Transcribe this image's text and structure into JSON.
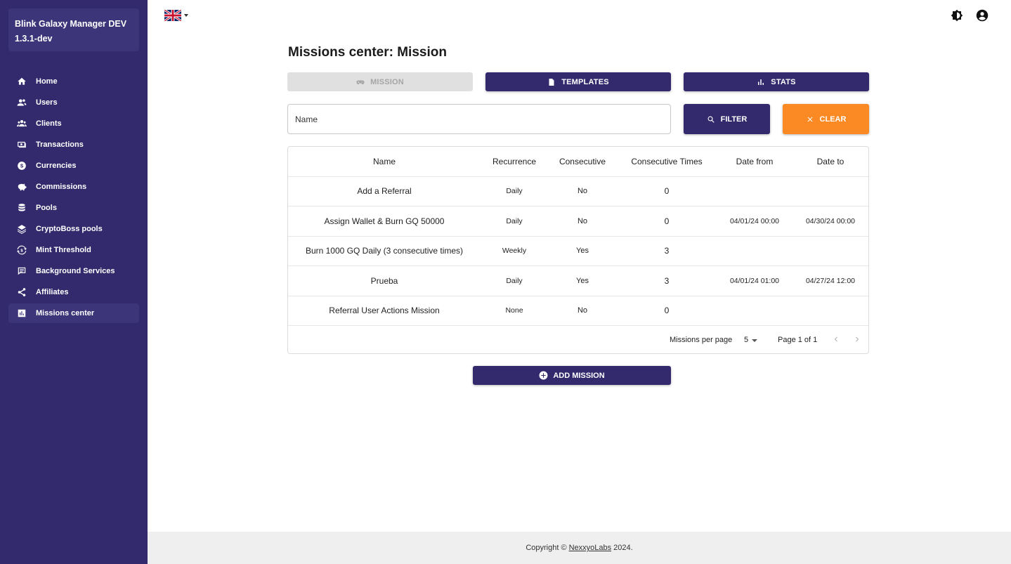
{
  "app": {
    "name_line1": "Blink Galaxy Manager DEV",
    "name_line2": "1.3.1-dev"
  },
  "sidebar": {
    "items": [
      {
        "label": "Home",
        "icon": "home-icon"
      },
      {
        "label": "Users",
        "icon": "users-icon"
      },
      {
        "label": "Clients",
        "icon": "clients-icon"
      },
      {
        "label": "Transactions",
        "icon": "transactions-icon"
      },
      {
        "label": "Currencies",
        "icon": "currency-icon"
      },
      {
        "label": "Commissions",
        "icon": "piggy-bank-icon"
      },
      {
        "label": "Pools",
        "icon": "database-icon"
      },
      {
        "label": "CryptoBoss pools",
        "icon": "layers-icon"
      },
      {
        "label": "Mint Threshold",
        "icon": "refresh-dollar-icon"
      },
      {
        "label": "Background Services",
        "icon": "list-box-icon"
      },
      {
        "label": "Affiliates",
        "icon": "share-icon"
      },
      {
        "label": "Missions center",
        "icon": "bar-chart-icon",
        "active": true
      }
    ]
  },
  "header": {
    "language": "en-GB",
    "language_icon": "uk-flag-icon",
    "theme_icon": "brightness-icon",
    "account_icon": "account-circle-icon"
  },
  "page": {
    "title": "Missions center: Mission",
    "tabs": {
      "mission": "MISSION",
      "templates": "TEMPLATES",
      "stats": "STATS"
    },
    "filter": {
      "name_placeholder": "Name",
      "name_value": "",
      "filter_label": "FILTER",
      "clear_label": "CLEAR"
    },
    "add_label": "ADD MISSION"
  },
  "colors": {
    "primary": "#332a6e",
    "accent": "#fb8a24",
    "disabled": "#e0e0e0"
  },
  "table": {
    "headers": {
      "name": "Name",
      "recurrence": "Recurrence",
      "consecutive": "Consecutive",
      "consecutive_times": "Consecutive Times",
      "date_from": "Date from",
      "date_to": "Date to"
    },
    "rows": [
      {
        "name": "Add a Referral",
        "recurrence": "Daily",
        "consecutive": "No",
        "consecutive_times": "0",
        "date_from": "",
        "date_to": ""
      },
      {
        "name": "Assign Wallet & Burn GQ 50000",
        "recurrence": "Daily",
        "consecutive": "No",
        "consecutive_times": "0",
        "date_from": "04/01/24 00:00",
        "date_to": "04/30/24 00:00"
      },
      {
        "name": "Burn 1000 GQ Daily (3 consecutive times)",
        "recurrence": "Weekly",
        "consecutive": "Yes",
        "consecutive_times": "3",
        "date_from": "",
        "date_to": ""
      },
      {
        "name": "Prueba",
        "recurrence": "Daily",
        "consecutive": "Yes",
        "consecutive_times": "3",
        "date_from": "04/01/24 01:00",
        "date_to": "04/27/24 12:00"
      },
      {
        "name": "Referral User Actions Mission",
        "recurrence": "None",
        "consecutive": "No",
        "consecutive_times": "0",
        "date_from": "",
        "date_to": ""
      }
    ],
    "pagination": {
      "per_page_label": "Missions per page",
      "per_page_value": "5",
      "page_info": "Page 1 of 1"
    }
  },
  "footer": {
    "prefix": "Copyright ©",
    "company": "NexxyoLabs",
    "suffix": "2024."
  }
}
